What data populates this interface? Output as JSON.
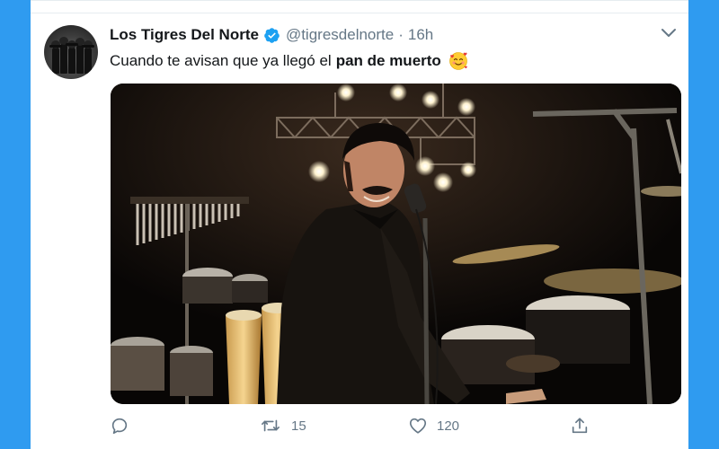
{
  "tweet": {
    "display_name": "Los Tigres Del Norte",
    "handle": "@tigresdelnorte",
    "separator": "·",
    "time": "16h",
    "text_plain": "Cuando te avisan que ya llegó el",
    "text_bold": "pan de muerto",
    "emoji": "smiling-face-with-hearts"
  },
  "actions": {
    "reply_count": "",
    "retweet_count": "15",
    "like_count": "120"
  },
  "colors": {
    "background": "#2f9bf0",
    "card": "#ffffff",
    "verified": "#1da1f2",
    "muted": "#657786",
    "text": "#14171a"
  }
}
